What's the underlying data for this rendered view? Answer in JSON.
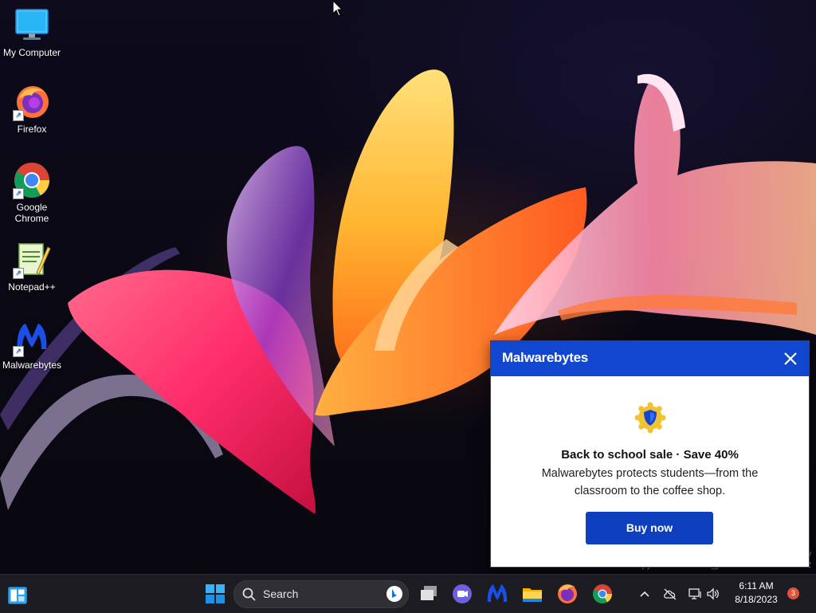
{
  "desktop": {
    "icons": [
      {
        "label": "My Computer",
        "icon": "monitor-icon"
      },
      {
        "label": "Firefox",
        "icon": "firefox-icon"
      },
      {
        "label": "Google Chrome",
        "icon": "chrome-icon"
      },
      {
        "label": "Notepad++",
        "icon": "notepadpp-icon"
      },
      {
        "label": "Malwarebytes",
        "icon": "malwarebytes-icon"
      }
    ],
    "watermark": {
      "line1": "w",
      "line2": "Evaluation copy. Build 25979.rs_prerelease.230811-1452"
    }
  },
  "toast": {
    "brand": "Malwarebytes",
    "title": "Back to school sale · Save 40%",
    "body": "Malwarebytes protects students—from the classroom to the coffee shop.",
    "button": "Buy now",
    "close_icon": "close-icon",
    "badge_icon": "shield-badge-icon"
  },
  "taskbar": {
    "search_label": "Search",
    "apps": [
      "windows-start-icon",
      "task-view-icon",
      "teams-chat-icon",
      "malwarebytes-icon",
      "file-explorer-icon",
      "firefox-icon",
      "chrome-icon"
    ],
    "tray": {
      "time": "6:11 AM",
      "date": "8/18/2023",
      "notification_count": "3"
    }
  },
  "colors": {
    "toast_header": "#1146cf",
    "toast_button": "#0e3fbf",
    "taskbar": "#1c1c22"
  }
}
